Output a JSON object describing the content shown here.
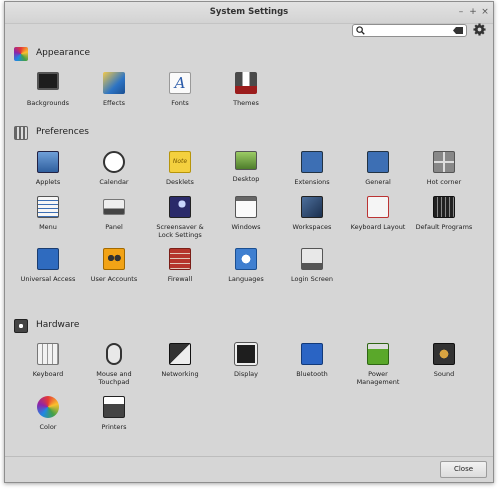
{
  "window": {
    "title": "System Settings",
    "minimize": "–",
    "maximize": "+",
    "close": "×"
  },
  "search": {
    "value": "",
    "placeholder": ""
  },
  "sections": [
    {
      "title": "Appearance",
      "items": [
        "Backgrounds",
        "Effects",
        "Fonts",
        "Themes"
      ]
    },
    {
      "title": "Preferences",
      "items": [
        "Applets",
        "Calendar",
        "Desklets",
        "Desktop",
        "Extensions",
        "General",
        "Hot corner",
        "Menu",
        "Panel",
        "Screensaver &\nLock Settings",
        "Windows",
        "Workspaces",
        "Keyboard Layout",
        "Default Programs",
        "Universal Access",
        "User Accounts",
        "Firewall",
        "Languages",
        "Login Screen"
      ]
    },
    {
      "title": "Hardware",
      "items": [
        "Keyboard",
        "Mouse and\nTouchpad",
        "Networking",
        "Display",
        "Bluetooth",
        "Power\nManagement",
        "Sound",
        "Color",
        "Printers"
      ]
    }
  ],
  "icon_glyphs": {
    "fonts": "A",
    "desklets": "Note"
  },
  "footer": {
    "close_label": "Close"
  },
  "colors": {
    "window_bg": "#d6d6d6",
    "titlebar": "#dadada",
    "accent_blue": "#3d6fb4"
  }
}
